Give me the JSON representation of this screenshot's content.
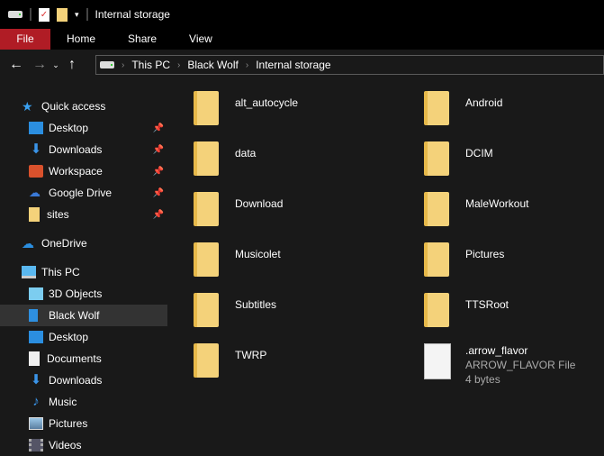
{
  "window": {
    "title": "Internal storage"
  },
  "ribbon": {
    "tabs": [
      "File",
      "Home",
      "Share",
      "View"
    ]
  },
  "address": {
    "crumbs": [
      "This PC",
      "Black Wolf",
      "Internal storage"
    ]
  },
  "nav": {
    "quick_access": "Quick access",
    "pinned": [
      "Desktop",
      "Downloads",
      "Workspace",
      "Google Drive",
      "sites"
    ],
    "onedrive": "OneDrive",
    "this_pc": "This PC",
    "pc_items": [
      "3D Objects",
      "Black Wolf",
      "Desktop",
      "Documents",
      "Downloads",
      "Music",
      "Pictures",
      "Videos"
    ],
    "selected": "Black Wolf"
  },
  "files": {
    "folders": [
      "alt_autocycle",
      "Android",
      "data",
      "DCIM",
      "Download",
      "MaleWorkout",
      "Musicolet",
      "Pictures",
      "Subtitles",
      "TTSRoot",
      "TWRP"
    ],
    "file": {
      "name": ".arrow_flavor",
      "type": "ARROW_FLAVOR File",
      "size": "4 bytes"
    }
  }
}
